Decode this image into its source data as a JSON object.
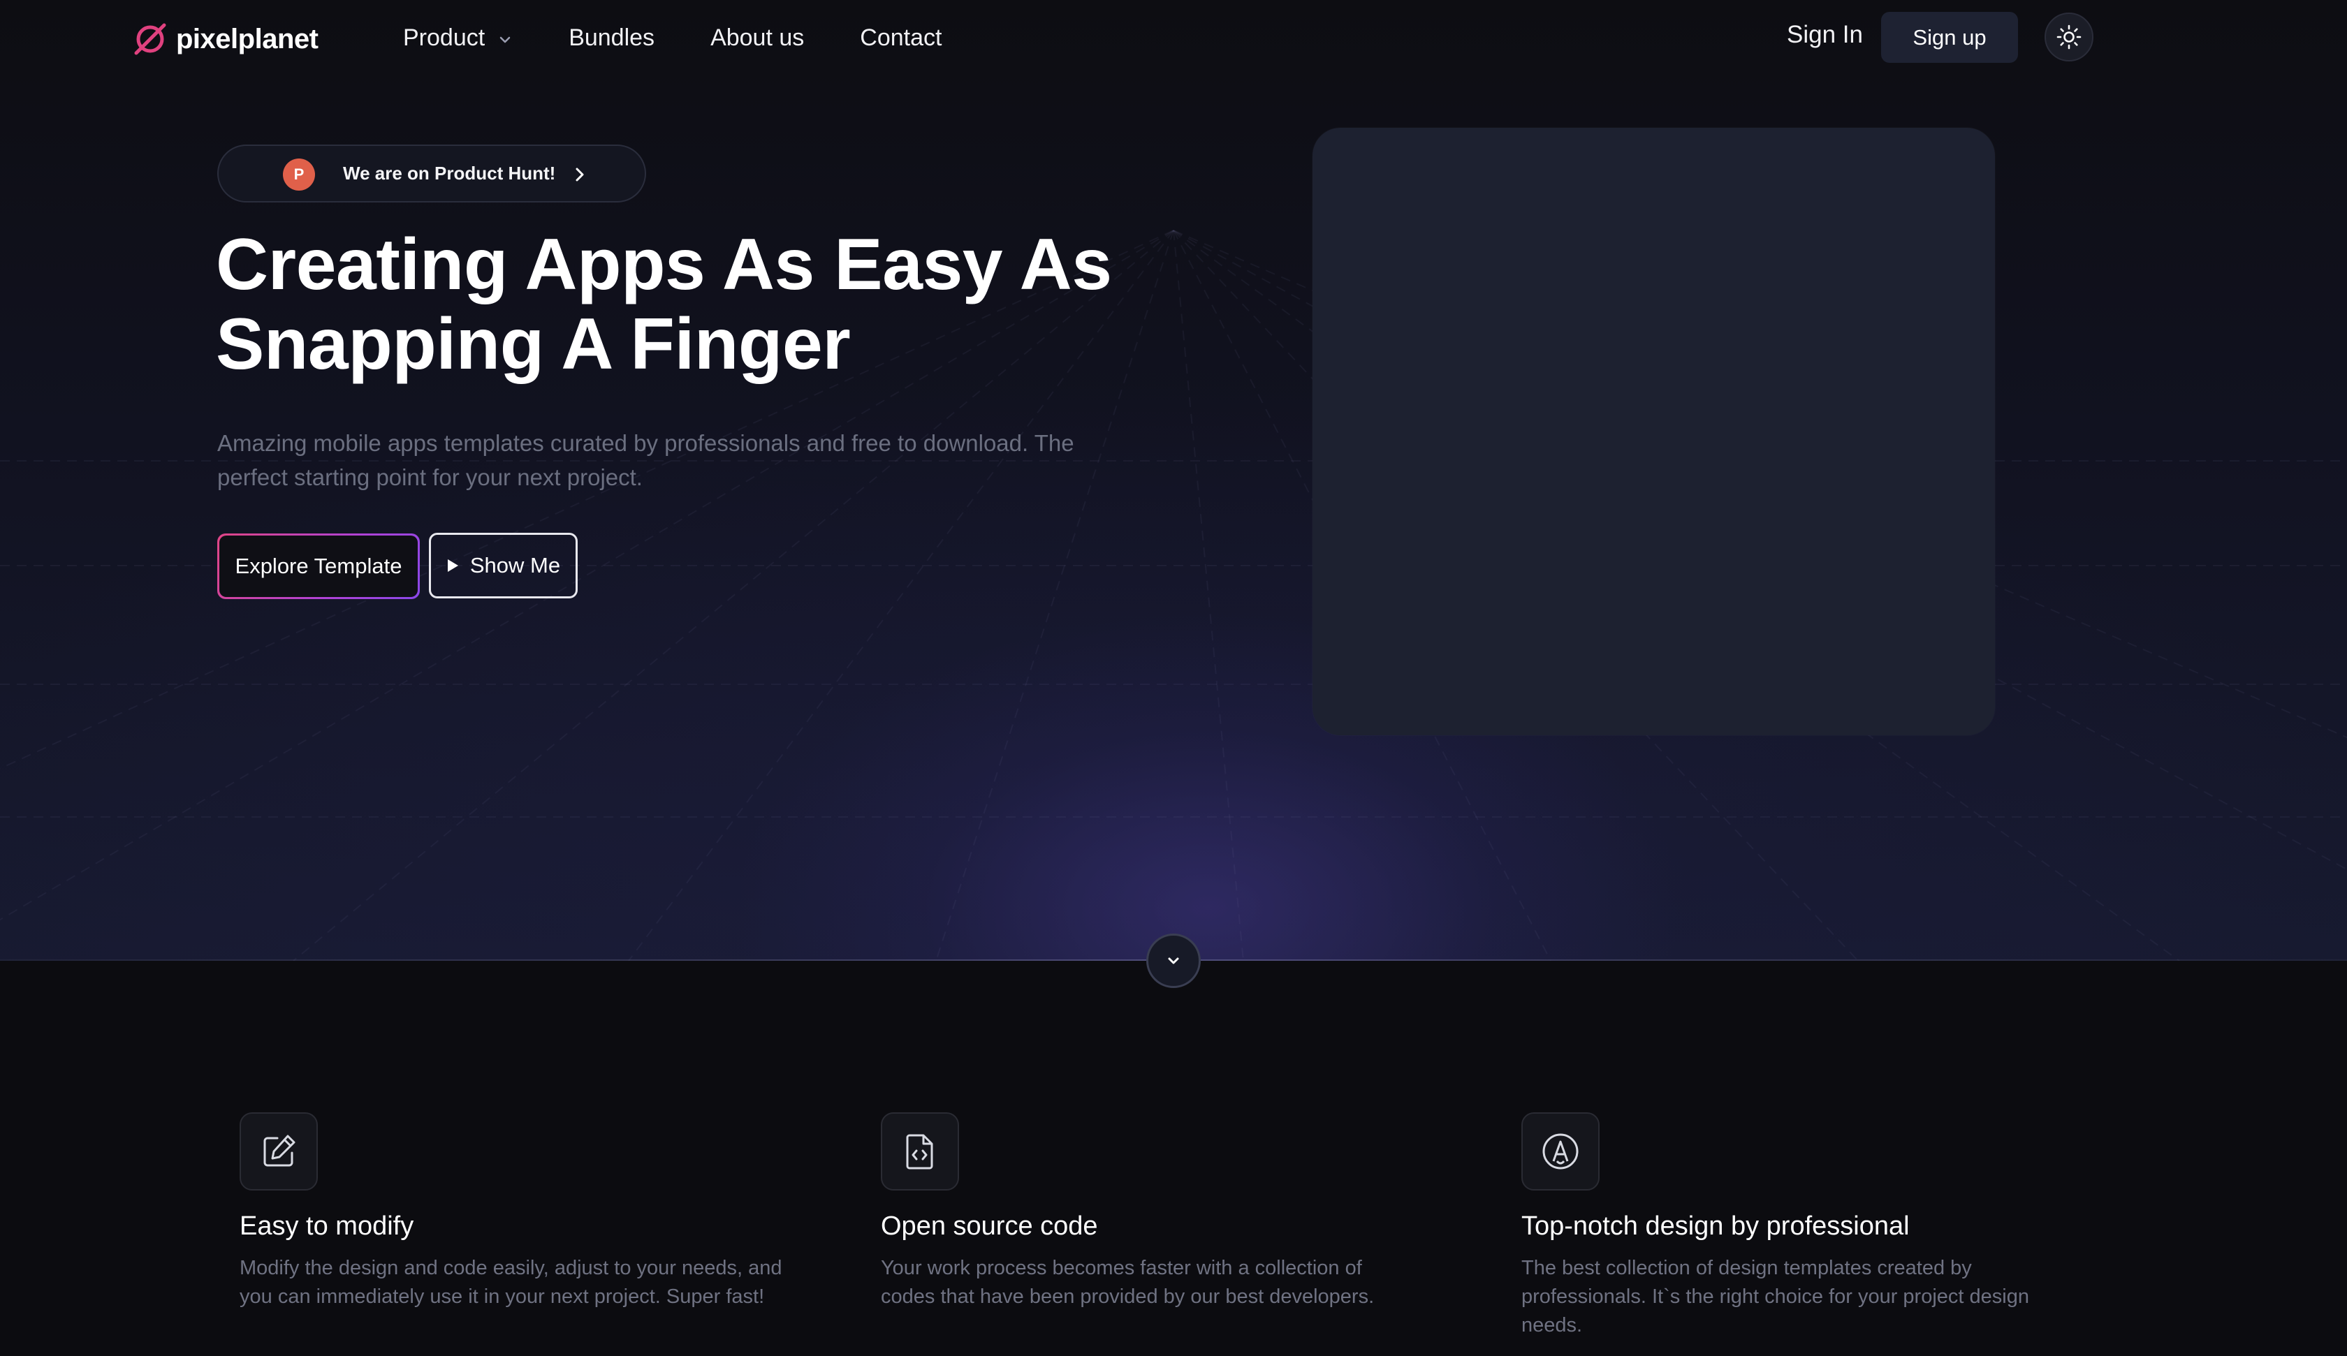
{
  "brand": {
    "name": "pixelplanet",
    "accent": "#e0417f"
  },
  "nav": {
    "links": [
      {
        "label": "Product",
        "has_dropdown": true
      },
      {
        "label": "Bundles"
      },
      {
        "label": "About us"
      },
      {
        "label": "Contact"
      }
    ],
    "sign_in": "Sign In",
    "sign_up": "Sign up",
    "theme_icon": "sun-icon"
  },
  "hero": {
    "badge_letter": "P",
    "badge_text": "We are on Product Hunt!",
    "headline_line1": "Creating Apps As Easy As",
    "headline_line2": "Snapping A Finger",
    "subtitle_line1": "Amazing mobile apps templates curated by professionals and free to download. The",
    "subtitle_line2": "perfect starting point for your next project.",
    "primary_button": "Explore Template",
    "secondary_button": "Show Me"
  },
  "features": [
    {
      "icon": "edit-icon",
      "title": "Easy to modify",
      "desc_lines": [
        "Modify the design and code easily, adjust to your needs, and",
        "you can immediately use it in your next project. Super fast!"
      ]
    },
    {
      "icon": "code-file-icon",
      "title": "Open source code",
      "desc_lines": [
        "Your work process becomes faster with a collection of",
        "codes that have been provided by our best developers."
      ]
    },
    {
      "icon": "design-pen-icon",
      "title": "Top-notch design by professional",
      "desc_lines": [
        "The best collection of design templates created by",
        "professionals. It`s the right choice for your project design",
        "needs."
      ]
    }
  ]
}
